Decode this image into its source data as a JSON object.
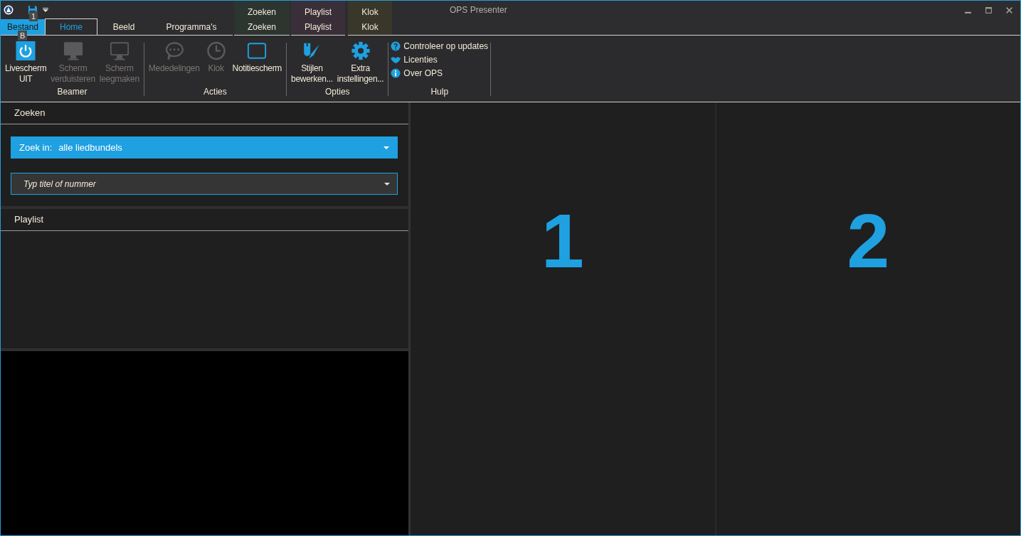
{
  "window": {
    "title": "OPS Presenter"
  },
  "quick_access": {
    "keytip": "1"
  },
  "file_tab": {
    "label": "Bestand",
    "keytip": "B"
  },
  "tabs": [
    {
      "label": "Home",
      "selected": true
    },
    {
      "label": "Beeld",
      "selected": false
    },
    {
      "label": "Programma's",
      "selected": false
    }
  ],
  "context_groups": [
    {
      "header": "Zoeken",
      "tab": "Zoeken",
      "color": "#2c3530"
    },
    {
      "header": "Playlist",
      "tab": "Playlist",
      "color": "#3a2f38"
    },
    {
      "header": "Klok",
      "tab": "Klok",
      "color": "#38372a"
    }
  ],
  "ribbon": {
    "groups": [
      {
        "label": "Beamer",
        "buttons": [
          {
            "lines": [
              "Livescherm",
              "UIT"
            ],
            "disabled": false
          },
          {
            "lines": [
              "Scherm",
              "verduisteren"
            ],
            "disabled": true
          },
          {
            "lines": [
              "Scherm",
              "leegmaken"
            ],
            "disabled": true
          }
        ]
      },
      {
        "label": "Acties",
        "buttons": [
          {
            "lines": [
              "Mededelingen"
            ],
            "disabled": true
          },
          {
            "lines": [
              "Klok"
            ],
            "disabled": true
          },
          {
            "lines": [
              "Notitiescherm"
            ],
            "disabled": false
          }
        ]
      },
      {
        "label": "Opties",
        "buttons": [
          {
            "lines": [
              "Stijlen",
              "bewerken..."
            ],
            "disabled": false
          },
          {
            "lines": [
              "Extra",
              "instellingen..."
            ],
            "disabled": false
          }
        ]
      },
      {
        "label": "Hulp",
        "links": [
          "Controleer op updates",
          "Licenties",
          "Over OPS"
        ]
      }
    ]
  },
  "search_panel": {
    "title": "Zoeken",
    "scope_label": "Zoek in:",
    "scope_value": "alle liedbundels",
    "query": {
      "placeholder": "Typ titel of nummer"
    }
  },
  "playlist_panel": {
    "title": "Playlist"
  },
  "screens": [
    "1",
    "2"
  ]
}
